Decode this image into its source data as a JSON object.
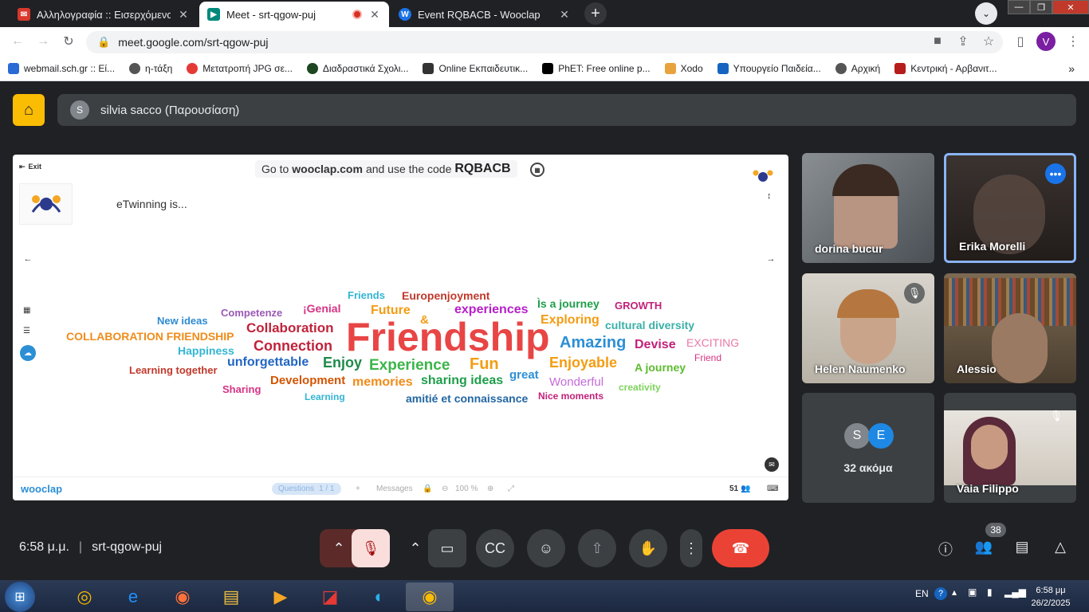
{
  "browser": {
    "tabs": [
      {
        "title": "Αλληλογραφία :: Εισερχόμενα",
        "active": false
      },
      {
        "title": "Meet - srt-qgow-puj",
        "active": true
      },
      {
        "title": "Event RQBACB - Wooclap",
        "active": false
      }
    ],
    "url": "meet.google.com/srt-qgow-puj",
    "profile_initial": "V",
    "bookmarks": [
      "webmail.sch.gr :: Εί...",
      "η-τάξη",
      "Μετατροπή JPG σε...",
      "Διαδραστικά Σχολι...",
      "Online Εκπαιδευτικ...",
      "PhET: Free online p...",
      "Xodo",
      "Υπουργείο Παιδεία...",
      "Αρχική",
      "Κεντρική - Αρβανιτ..."
    ]
  },
  "meet": {
    "presenter_initial": "S",
    "presenter_label": "silvia sacco (Παρουσίαση)",
    "time": "6:58 μ.μ.",
    "meeting_code": "srt-qgow-puj",
    "participants_count": "38",
    "tiles": [
      {
        "name": "dorina bucur"
      },
      {
        "name": "Erika Morelli"
      },
      {
        "name": "Helen Naumenko"
      },
      {
        "name": "Alessio"
      },
      {
        "name": "32 ακόμα",
        "initials": [
          "S",
          "E"
        ]
      },
      {
        "name": "Vaia Filippo"
      }
    ]
  },
  "wooclap": {
    "exit_label": "Exit",
    "instruction_prefix": "Go to",
    "instruction_site": "wooclap.com",
    "instruction_mid": "and use the code",
    "code": "RQBACB",
    "question": "eTwinning is...",
    "brand": "wooclap",
    "footer_questions": "Questions",
    "footer_page": "1 / 1",
    "footer_messages": "Messages",
    "footer_zoom": "100 %",
    "footer_count": "51",
    "words": [
      {
        "text": "Friendship",
        "color": "#e84545"
      },
      {
        "text": "Friends",
        "color": "#33b5d4"
      },
      {
        "text": "Europenjoyment",
        "color": "#c0392b"
      },
      {
        "text": "Ìs a journey",
        "color": "#1e9e4a"
      },
      {
        "text": "GROWTH",
        "color": "#c2217a"
      },
      {
        "text": "Competenze",
        "color": "#9b59b6"
      },
      {
        "text": "¡Genial",
        "color": "#d63384"
      },
      {
        "text": "Future",
        "color": "#f39c12"
      },
      {
        "text": "experiences",
        "color": "#b620c9"
      },
      {
        "text": "New ideas",
        "color": "#2e8bd4"
      },
      {
        "text": "&",
        "color": "#f39c12"
      },
      {
        "text": "Exploring",
        "color": "#f39c12"
      },
      {
        "text": "cultural diversity",
        "color": "#3ab0a8"
      },
      {
        "text": "COLLABORATION FRIENDSHIP",
        "color": "#f08c1a"
      },
      {
        "text": "Collaboration",
        "color": "#c0233b"
      },
      {
        "text": "Amazing",
        "color": "#2c8fd6"
      },
      {
        "text": "Devise",
        "color": "#c2217a"
      },
      {
        "text": "EXCITING",
        "color": "#e879a6"
      },
      {
        "text": "Happiness",
        "color": "#33b5d4"
      },
      {
        "text": "Connection",
        "color": "#c0233b"
      },
      {
        "text": "Friend",
        "color": "#d63384"
      },
      {
        "text": "unforgettable",
        "color": "#2266c2"
      },
      {
        "text": "Enjoy",
        "color": "#1e8a4a"
      },
      {
        "text": "Experience",
        "color": "#3cb54a"
      },
      {
        "text": "Fun",
        "color": "#f39c12"
      },
      {
        "text": "Enjoyable",
        "color": "#f39c12"
      },
      {
        "text": "Learning together",
        "color": "#c0392b"
      },
      {
        "text": "great",
        "color": "#2c8fd6"
      },
      {
        "text": "A journey",
        "color": "#5dbb2f"
      },
      {
        "text": "Development",
        "color": "#d35400"
      },
      {
        "text": "sharing ideas",
        "color": "#1e9e4a"
      },
      {
        "text": "memories",
        "color": "#f08c1a"
      },
      {
        "text": "Wonderful",
        "color": "#c56bd9"
      },
      {
        "text": "Sharing",
        "color": "#d63384"
      },
      {
        "text": "creativity",
        "color": "#7dd35b"
      },
      {
        "text": "Learning",
        "color": "#33b5d4"
      },
      {
        "text": "amitié et connaissance",
        "color": "#2266a2"
      },
      {
        "text": "Nice moments",
        "color": "#c2217a"
      }
    ]
  },
  "taskbar": {
    "lang": "EN",
    "time": "6:58 μμ",
    "date": "26/2/2025"
  }
}
